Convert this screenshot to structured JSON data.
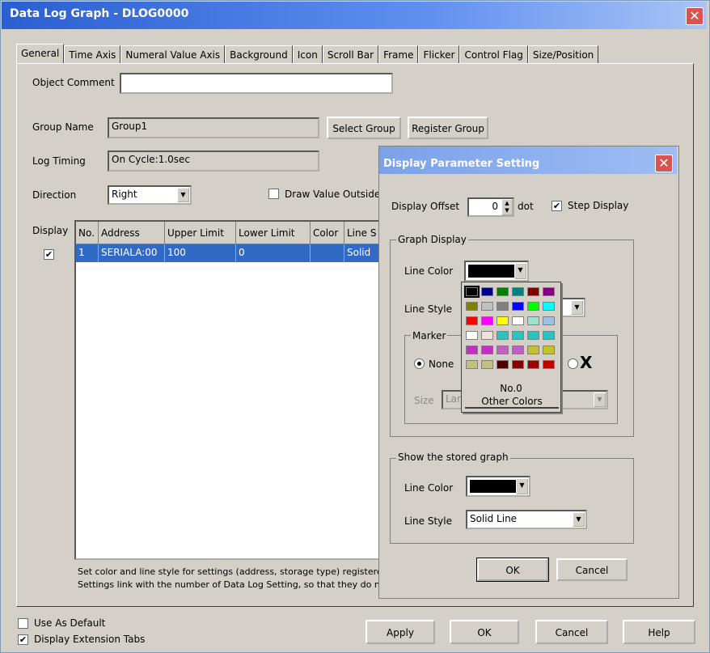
{
  "window": {
    "title": "Data Log Graph - DLOG0000",
    "close": "✕"
  },
  "tabs": [
    "General",
    "Time Axis",
    "Numeral Value Axis",
    "Background",
    "Icon",
    "Scroll Bar",
    "Frame",
    "Flicker",
    "Control Flag",
    "Size/Position"
  ],
  "general": {
    "object_comment_label": "Object Comment",
    "object_comment_value": "",
    "group_name_label": "Group Name",
    "group_name_value": "Group1",
    "select_group": "Select Group",
    "register_group": "Register Group",
    "log_timing_label": "Log Timing",
    "log_timing_value": "On Cycle:1.0sec",
    "direction_label": "Direction",
    "direction_value": "Right",
    "draw_value_outside": "Draw Value Outside o",
    "display_label": "Display",
    "display_checked": "✔",
    "table_headers": [
      "No.",
      "Address",
      "Upper Limit",
      "Lower Limit",
      "Color",
      "Line S"
    ],
    "table_row": [
      "1",
      "SERIALA:00",
      "100",
      "0",
      "",
      "Solid"
    ],
    "note_line1": "Set color and line style for settings (address, storage type) registered i",
    "note_line2": "Settings link with the number of Data Log Setting, so that they do not"
  },
  "footer": {
    "use_as_default": "Use As Default",
    "display_extension_tabs": "Display Extension Tabs",
    "display_extension_checked": "✔",
    "apply": "Apply",
    "ok": "OK",
    "cancel": "Cancel",
    "help": "Help"
  },
  "dialog": {
    "title": "Display Parameter Setting",
    "close": "✕",
    "display_offset_label": "Display Offset",
    "display_offset_value": "0",
    "display_offset_unit": "dot",
    "step_display_label": "Step Display",
    "step_display_checked": "✔",
    "graph_display_group": "Graph Display",
    "line_color_label": "Line Color",
    "line_style_label": "Line Style",
    "marker_group": "Marker",
    "marker_none": "None",
    "marker_x": "X",
    "size_label": "Size",
    "size_value": "Lar",
    "palette_no": "No.0",
    "palette_other": "Other Colors",
    "stored_group": "Show the stored graph",
    "stored_line_color_label": "Line Color",
    "stored_line_style_label": "Line Style",
    "stored_line_style_value": "Solid Line",
    "ok": "OK",
    "cancel": "Cancel",
    "palette_colors": [
      "#000000",
      "#000080",
      "#008000",
      "#008080",
      "#800000",
      "#800080",
      "#808000",
      "#c0c0c0",
      "#808080",
      "#0000ff",
      "#00ff00",
      "#00ffff",
      "#ff0000",
      "#ff00ff",
      "#ffff00",
      "#ffffff",
      "#a0e0d0",
      "#a0c0e0",
      "#ffffff",
      "#f0e0e0",
      "#30c0c0",
      "#30c0c0",
      "#30c0c0",
      "#30c0c0",
      "#c030c0",
      "#c030c0",
      "#c060c0",
      "#c060c0",
      "#c0c030",
      "#c0c030",
      "#c0c080",
      "#c0c080",
      "#500000",
      "#800000",
      "#a00000",
      "#c00000"
    ]
  }
}
